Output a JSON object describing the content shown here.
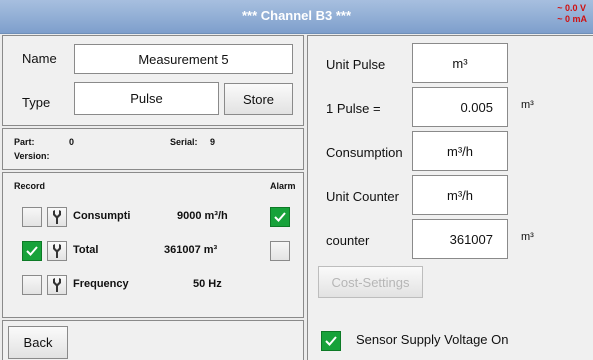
{
  "header": {
    "title": "*** Channel B3 ***",
    "voltage": "~ 0.0 V",
    "current": "~ 0 mA"
  },
  "left": {
    "name_label": "Name",
    "name_value": "Measurement 5",
    "type_label": "Type",
    "type_value": "Pulse",
    "store_label": "Store",
    "part_label": "Part:",
    "part_value": "0",
    "serial_label": "Serial:",
    "serial_value": "9",
    "version_label": "Version:",
    "record_label": "Record",
    "alarm_label": "Alarm",
    "rows": [
      {
        "label": "Consumpti",
        "value": "9000 m³/h",
        "record_checked": false,
        "alarm_checked": true
      },
      {
        "label": "Total",
        "value": "361007 m³",
        "record_checked": true,
        "alarm_checked": false
      },
      {
        "label": "Frequency",
        "value": "50 Hz",
        "record_checked": false
      }
    ],
    "back_label": "Back"
  },
  "right": {
    "unit_pulse_label": "Unit Pulse",
    "unit_pulse_value": "m³",
    "pulse_label": "1 Pulse =",
    "pulse_value": "0.005",
    "pulse_unit": "m³",
    "consumption_label": "Consumption",
    "consumption_value": "m³/h",
    "unit_counter_label": "Unit Counter",
    "unit_counter_value": "m³/h",
    "counter_label": "counter",
    "counter_value": "361007",
    "counter_unit": "m³",
    "cost_settings_label": "Cost-Settings",
    "sensor_supply_label": "Sensor Supply Voltage On",
    "sensor_supply_checked": true
  },
  "icons": {
    "check": "check-icon",
    "wrench": "wrench-icon"
  },
  "colors": {
    "title_bar": "#8fa9d2",
    "check_green": "#17a23a",
    "readout_red": "#d01010"
  }
}
